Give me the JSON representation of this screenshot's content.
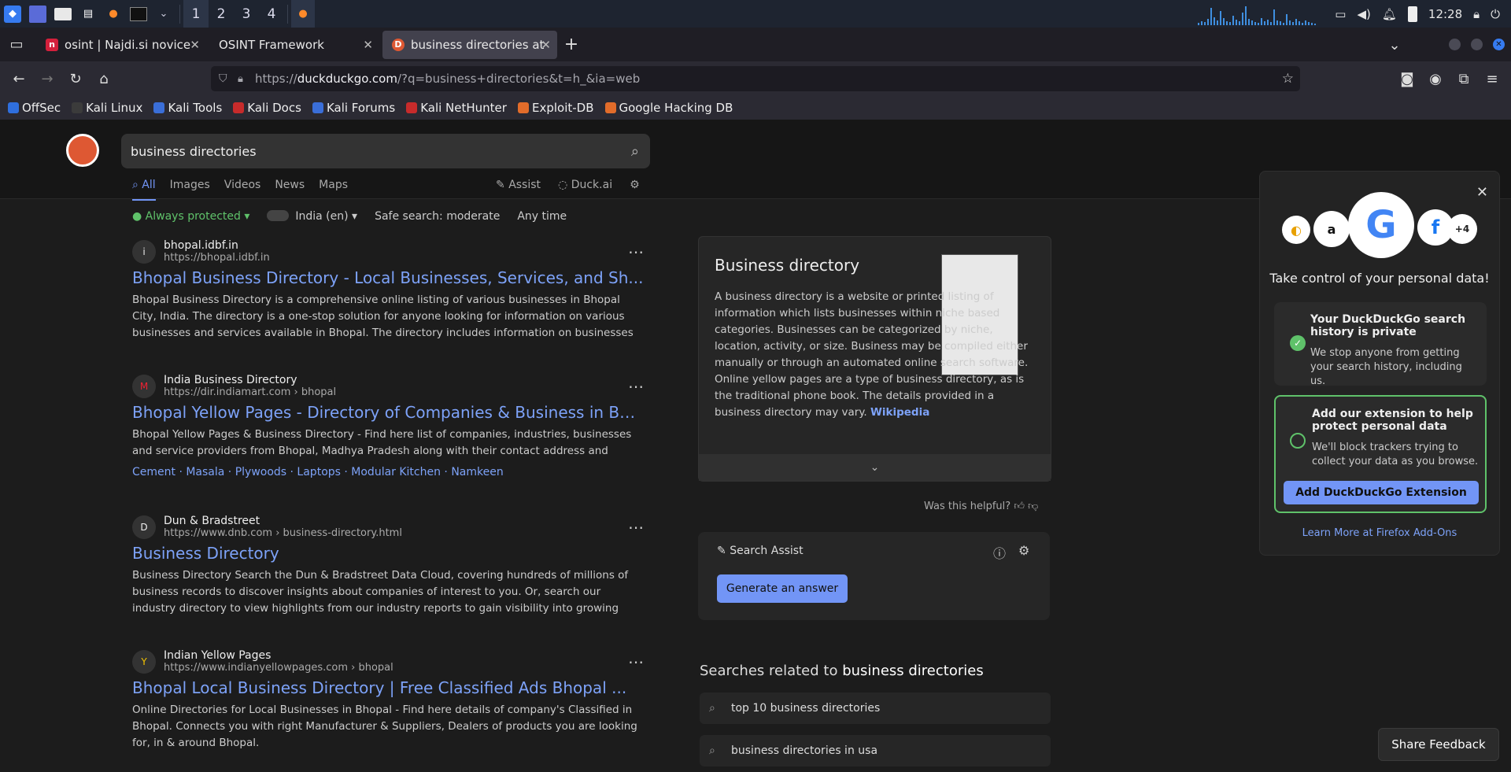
{
  "taskbar": {
    "workspaces": [
      "1",
      "2",
      "3",
      "4"
    ],
    "clock": "12:28"
  },
  "tabs": [
    {
      "label": "osint | Najdi.si novice",
      "favicon": "n",
      "color": "#d4203c"
    },
    {
      "label": "OSINT Framework",
      "favicon": "",
      "color": ""
    },
    {
      "label": "business directories at Du",
      "favicon": "D",
      "color": "#de5833"
    }
  ],
  "url": {
    "prefix": "https://",
    "domain": "duckduckgo.com",
    "path": "/?q=business+directories&t=h_&ia=web"
  },
  "bookmarks": [
    "OffSec",
    "Kali Linux",
    "Kali Tools",
    "Kali Docs",
    "Kali Forums",
    "Kali NetHunter",
    "Exploit-DB",
    "Google Hacking DB"
  ],
  "search": {
    "query": "business directories"
  },
  "nav_tabs": [
    "All",
    "Images",
    "Videos",
    "News",
    "Maps"
  ],
  "assist_tab": "Assist",
  "duckai_tab": "Duck.ai",
  "filters": {
    "protected": "Always protected",
    "region": "India (en)",
    "safe": "Safe search: moderate",
    "time": "Any time"
  },
  "results": [
    {
      "site": "bhopal.idbf.in",
      "url": "https://bhopal.idbf.in",
      "icon": "i",
      "title": "Bhopal Business Directory - Local Businesses, Services, and Sh...",
      "snippet": "Bhopal Business Directory is a comprehensive online listing of various businesses in Bhopal City, India. The directory is a one-stop solution for anyone looking for information on various businesses and services available in Bhopal. The directory includes information on businesses from various categorie..."
    },
    {
      "site": "India Business Directory",
      "url": "https://dir.indiamart.com › bhopal",
      "icon": "M",
      "title": "Bhopal Yellow Pages - Directory of Companies & Business in Bh...",
      "snippet": "Bhopal Yellow Pages & Business Directory - Find here list of companies, industries, businesses and service providers from Bhopal, Madhya Pradesh along with their contact address and phone numbers.",
      "links": "Cement · Masala · Plywoods · Laptops · Modular Kitchen · Namkeen"
    },
    {
      "site": "Dun & Bradstreet",
      "url": "https://www.dnb.com › business-directory.html",
      "icon": "D",
      "title": "Business Directory",
      "snippet": "Business Directory Search the Dun & Bradstreet Data Cloud, covering hundreds of millions of business records to discover insights about companies of interest to you. Or, search our industry directory to view highlights from our industry reports to gain visibility into growing markets and understand trends..."
    },
    {
      "site": "Indian Yellow Pages",
      "url": "https://www.indianyellowpages.com › bhopal",
      "icon": "Y",
      "title": "Bhopal Local Business Directory | Free Classified Ads Bhopal ...",
      "snippet": "Online Directories for Local Businesses in Bhopal - Find here details of company's Classified in Bhopal. Connects you with right Manufacturer & Suppliers, Dealers of products you are looking for, in & around Bhopal."
    }
  ],
  "knowledge": {
    "title": "Business directory",
    "text": "A business directory is a website or printed listing of information which lists businesses within niche based categories. Businesses can be categorized by niche, location, activity, or size. Business may be compiled either manually or through an automated online search software. Online yellow pages are a type of business directory, as is the traditional phone book. The details provided in a business directory may vary.",
    "source": "Wikipedia",
    "helpful": "Was this helpful?"
  },
  "search_assist": {
    "title": "Search Assist",
    "button": "Generate an answer"
  },
  "related": {
    "prefix": "Searches related to ",
    "term": "business directories",
    "items": [
      "top 10 business directories",
      "business directories in usa"
    ]
  },
  "popup": {
    "headline": "Take control of your personal data!",
    "card1_title": "Your DuckDuckGo search history is private",
    "card1_text": "We stop anyone from getting your search history, including us.",
    "card2_title": "Add our extension to help protect personal data",
    "card2_text": "We'll block trackers trying to collect your data as you browse.",
    "button": "Add DuckDuckGo Extension",
    "link": "Learn More at Firefox Add-Ons",
    "more": "+4"
  },
  "feedback": "Share Feedback"
}
